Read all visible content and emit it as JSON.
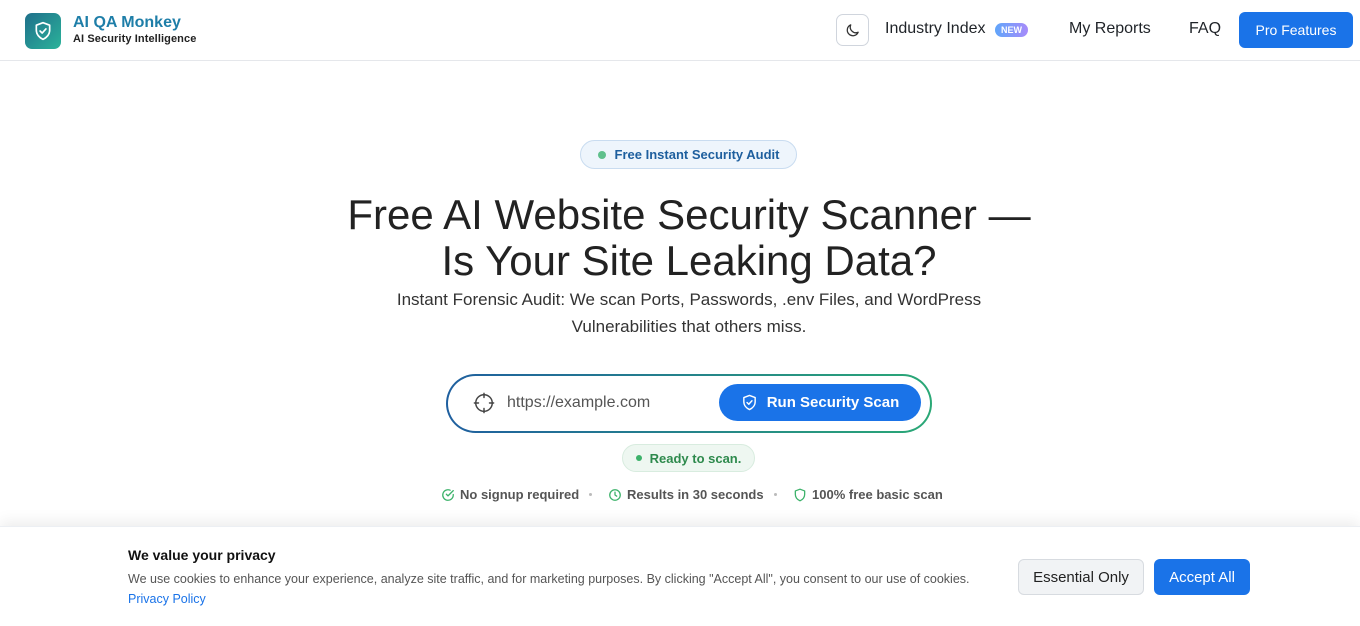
{
  "header": {
    "brand_title": "AI QA Monkey",
    "brand_subtitle": "AI Security Intelligence",
    "logo_icon": "shield-check-icon",
    "theme_icon": "moon-icon",
    "nav": {
      "industry_index": "Industry Index",
      "industry_badge": "NEW",
      "my_reports": "My Reports",
      "faq": "FAQ"
    },
    "pro_button": "Pro Features"
  },
  "hero": {
    "pill_label": "Free Instant Security Audit",
    "title": "Free AI Website Security Scanner — Is Your Site Leaking Data?",
    "subtitle": "Instant Forensic Audit: We scan Ports, Passwords, .env Files, and WordPress Vulnerabilities that others miss.",
    "url_placeholder": "https://example.com",
    "scan_button": "Run Security Scan",
    "status": "Ready to scan.",
    "features": [
      {
        "label": "No signup required",
        "icon": "check-circle-icon"
      },
      {
        "label": "Results in 30 seconds",
        "icon": "clock-icon"
      },
      {
        "label": "100% free basic scan",
        "icon": "shield-icon"
      }
    ]
  },
  "cookie_banner": {
    "title": "We value your privacy",
    "text": "We use cookies to enhance your experience, analyze site traffic, and for marketing purposes. By clicking \"Accept All\", you consent to our use of cookies.",
    "privacy_link": "Privacy Policy",
    "essential_button": "Essential Only",
    "accept_button": "Accept All"
  },
  "colors": {
    "accent": "#1a73e8",
    "brand": "#1e7ea8",
    "success": "#2e8a4d"
  }
}
